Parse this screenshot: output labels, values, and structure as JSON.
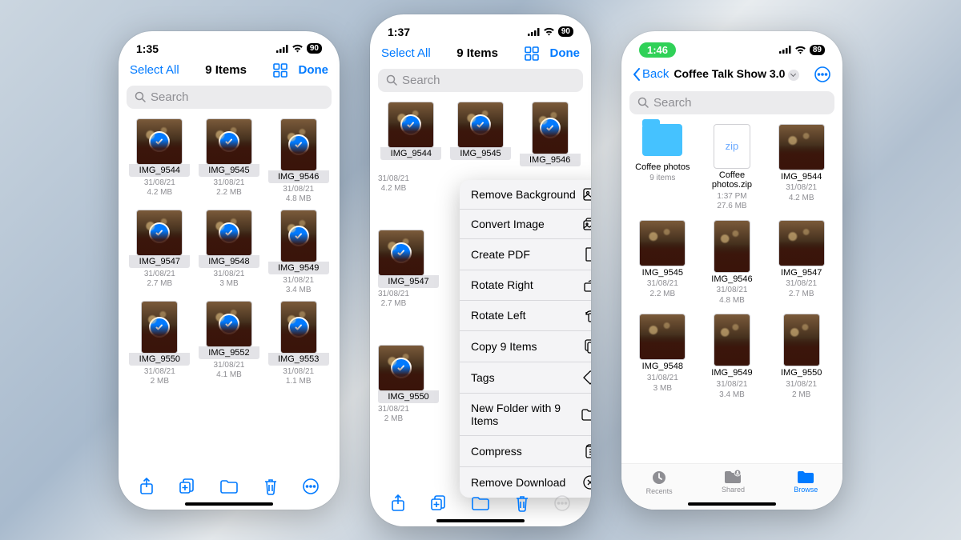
{
  "statusIcons": {
    "signal": "􀙇",
    "wifi": "􀙈"
  },
  "screenA": {
    "time": "1:35",
    "battery": "90",
    "nav": {
      "left": "Select All",
      "title": "9 Items",
      "done": "Done"
    },
    "searchPlaceholder": "Search",
    "items": [
      {
        "name": "IMG_9544",
        "date": "31/08/21",
        "size": "4.2 MB",
        "tall": false
      },
      {
        "name": "IMG_9545",
        "date": "31/08/21",
        "size": "2.2 MB",
        "tall": false
      },
      {
        "name": "IMG_9546",
        "date": "31/08/21",
        "size": "4.8 MB",
        "tall": true
      },
      {
        "name": "IMG_9547",
        "date": "31/08/21",
        "size": "2.7 MB",
        "tall": false
      },
      {
        "name": "IMG_9548",
        "date": "31/08/21",
        "size": "3 MB",
        "tall": false
      },
      {
        "name": "IMG_9549",
        "date": "31/08/21",
        "size": "3.4 MB",
        "tall": true
      },
      {
        "name": "IMG_9550",
        "date": "31/08/21",
        "size": "2 MB",
        "tall": true
      },
      {
        "name": "IMG_9552",
        "date": "31/08/21",
        "size": "4.1 MB",
        "tall": false
      },
      {
        "name": "IMG_9553",
        "date": "31/08/21",
        "size": "1.1 MB",
        "tall": true
      }
    ]
  },
  "screenB": {
    "time": "1:37",
    "battery": "90",
    "nav": {
      "left": "Select All",
      "title": "9 Items",
      "done": "Done"
    },
    "searchPlaceholder": "Search",
    "column": [
      {
        "name": "IMG_9544",
        "date": "31/08/21",
        "size": "4.2 MB"
      },
      {
        "name": "IMG_9547",
        "date": "31/08/21",
        "size": "2.7 MB"
      },
      {
        "name": "IMG_9550",
        "date": "31/08/21",
        "size": "2 MB"
      }
    ],
    "topRow": [
      {
        "name": "IMG_9544"
      },
      {
        "name": "IMG_9545"
      },
      {
        "name": "IMG_9546",
        "tall": true
      }
    ],
    "menu": [
      {
        "label": "Remove Background",
        "icon": "rmbg"
      },
      {
        "label": "Convert Image",
        "icon": "convert"
      },
      {
        "label": "Create PDF",
        "icon": "pdf"
      },
      {
        "label": "Rotate Right",
        "icon": "rotr"
      },
      {
        "label": "Rotate Left",
        "icon": "rotl"
      },
      {
        "label": "Copy 9 Items",
        "icon": "copy"
      },
      {
        "label": "Tags",
        "icon": "tag"
      },
      {
        "label": "New Folder with 9 Items",
        "icon": "newfolder"
      },
      {
        "label": "Compress",
        "icon": "compress"
      },
      {
        "label": "Remove Download",
        "icon": "rmdl"
      }
    ]
  },
  "screenC": {
    "time": "1:46",
    "battery": "89",
    "nav": {
      "back": "Back",
      "title": "Coffee Talk Show 3.0"
    },
    "searchPlaceholder": "Search",
    "items": [
      {
        "type": "folder",
        "name": "Coffee photos",
        "meta1": "9 items",
        "meta2": ""
      },
      {
        "type": "zip",
        "name": "Coffee photos.zip",
        "meta1": "1:37 PM",
        "meta2": "27.6 MB"
      },
      {
        "type": "img",
        "name": "IMG_9544",
        "meta1": "31/08/21",
        "meta2": "4.2 MB"
      },
      {
        "type": "img",
        "name": "IMG_9545",
        "meta1": "31/08/21",
        "meta2": "2.2 MB"
      },
      {
        "type": "img",
        "name": "IMG_9546",
        "meta1": "31/08/21",
        "meta2": "4.8 MB",
        "tall": true
      },
      {
        "type": "img",
        "name": "IMG_9547",
        "meta1": "31/08/21",
        "meta2": "2.7 MB"
      },
      {
        "type": "img",
        "name": "IMG_9548",
        "meta1": "31/08/21",
        "meta2": "3 MB"
      },
      {
        "type": "img",
        "name": "IMG_9549",
        "meta1": "31/08/21",
        "meta2": "3.4 MB",
        "tall": true
      },
      {
        "type": "img",
        "name": "IMG_9550",
        "meta1": "31/08/21",
        "meta2": "2 MB",
        "tall": true
      }
    ],
    "tabs": {
      "recents": "Recents",
      "shared": "Shared",
      "browse": "Browse"
    }
  }
}
